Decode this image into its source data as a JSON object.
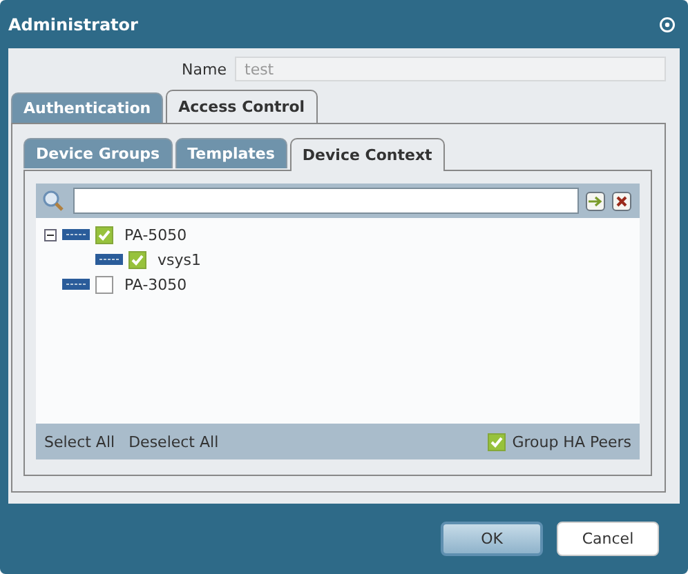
{
  "window": {
    "title": "Administrator"
  },
  "name_field": {
    "label": "Name",
    "placeholder": "test"
  },
  "tabs": [
    {
      "label": "Authentication",
      "selected": false
    },
    {
      "label": "Access Control",
      "selected": true
    }
  ],
  "sub_tabs": [
    {
      "label": "Device Groups",
      "selected": false
    },
    {
      "label": "Templates",
      "selected": false
    },
    {
      "label": "Device Context",
      "selected": true
    }
  ],
  "tree": [
    {
      "label": "PA-5050",
      "checked": true,
      "expanded": true,
      "children": [
        {
          "label": "vsys1",
          "checked": true
        }
      ]
    },
    {
      "label": "PA-3050",
      "checked": false
    }
  ],
  "footer": {
    "links": [
      "Select All",
      "Deselect All"
    ],
    "group_ha_peers": {
      "label": "Group HA Peers",
      "checked": true
    }
  },
  "buttons": [
    {
      "label": "OK",
      "selected": true
    },
    {
      "label": "Cancel",
      "selected": false
    }
  ]
}
